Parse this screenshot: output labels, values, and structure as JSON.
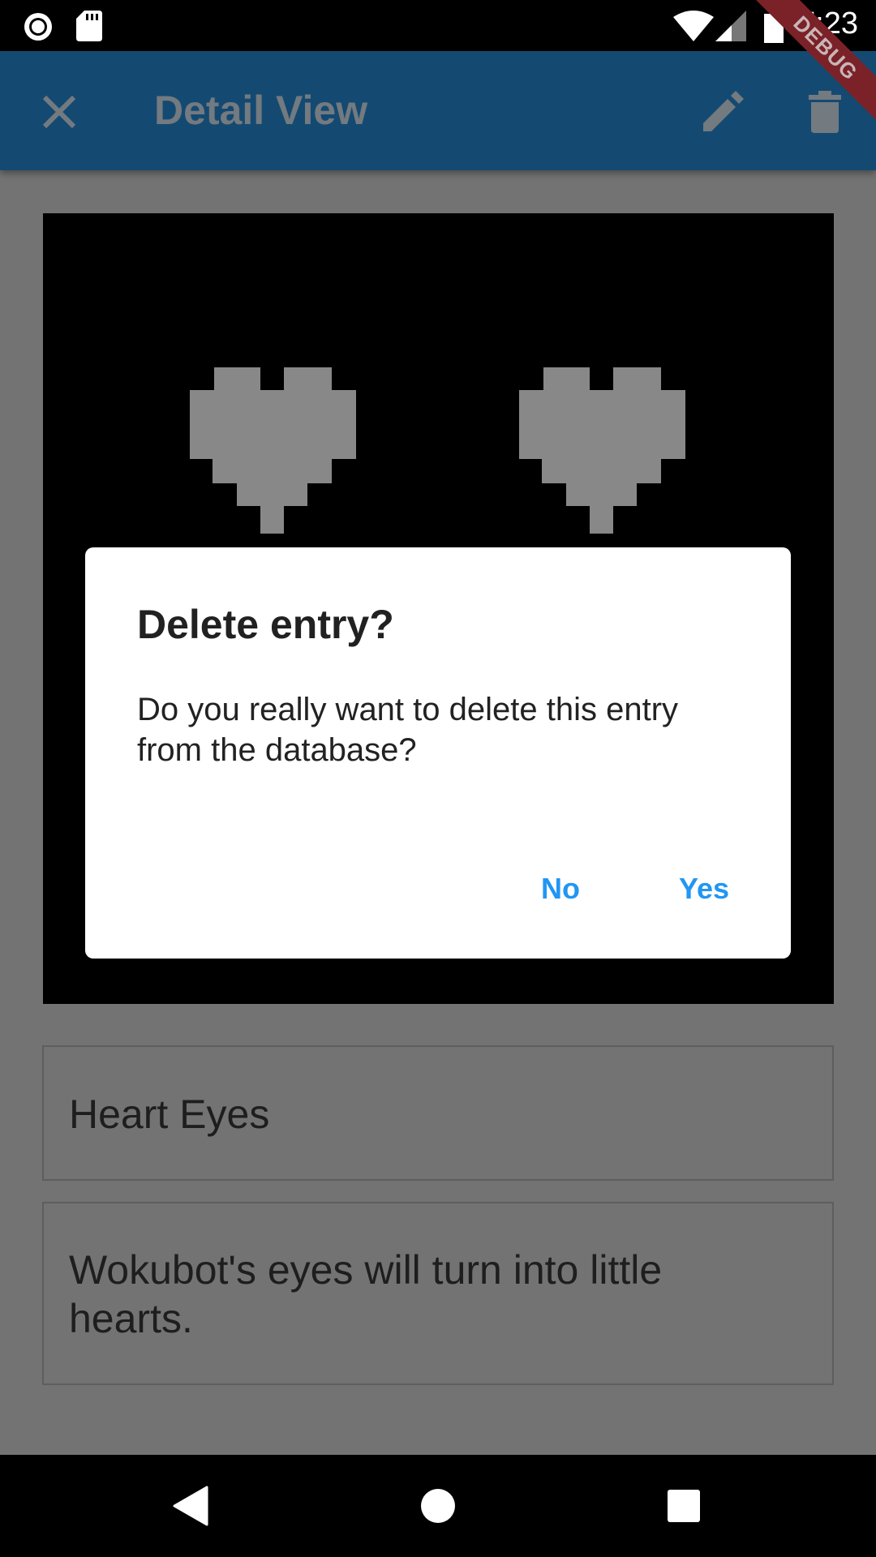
{
  "status_bar": {
    "time": "7:23",
    "icons": [
      "record-icon",
      "sd-card-icon",
      "wifi-icon",
      "signal-icon",
      "battery-icon"
    ]
  },
  "app_bar": {
    "title": "Detail View",
    "close_icon": "close-icon",
    "edit_icon": "edit-icon",
    "delete_icon": "trash-icon",
    "background": "#144a72"
  },
  "debug_banner": "DEBUG",
  "entry": {
    "image": "heart-eyes-pixel-art",
    "title": "Heart Eyes",
    "description": "Wokubot's eyes will turn into little hearts."
  },
  "dialog": {
    "title": "Delete entry?",
    "message": "Do you really want to delete this entry from the database?",
    "no_label": "No",
    "yes_label": "Yes",
    "accent": "#2196f3"
  },
  "nav_bar": {
    "icons": [
      "back-icon",
      "home-icon",
      "recents-icon"
    ]
  }
}
